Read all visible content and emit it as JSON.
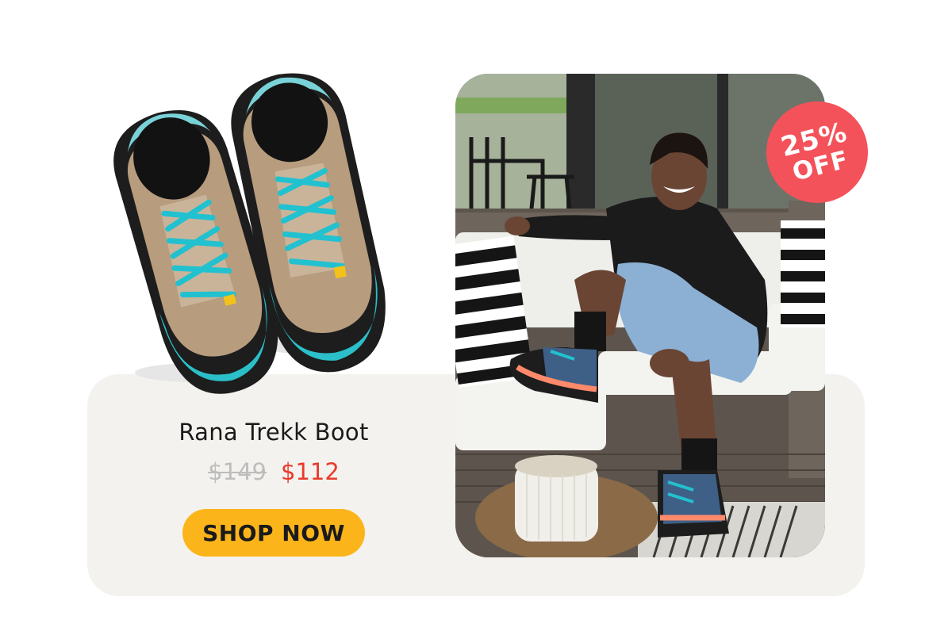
{
  "product": {
    "name": "Rana Trekk Boot",
    "original_price": "$149",
    "sale_price": "$112"
  },
  "cta": {
    "label": "SHOP NOW"
  },
  "badge": {
    "percent": "25%",
    "label": "OFF"
  },
  "colors": {
    "panel_bg": "#f3f2ee",
    "sale_price": "#e9392b",
    "original_price": "#bdbdbd",
    "cta_bg": "#fbb51b",
    "badge_bg": "#f4525a",
    "boot_teal": "#2bbfc9",
    "boot_tan": "#b79c7e"
  },
  "images": {
    "product_photo": "hiking-boots-top-view",
    "lifestyle_photo": "man-on-patio-sofa-wearing-boots"
  }
}
